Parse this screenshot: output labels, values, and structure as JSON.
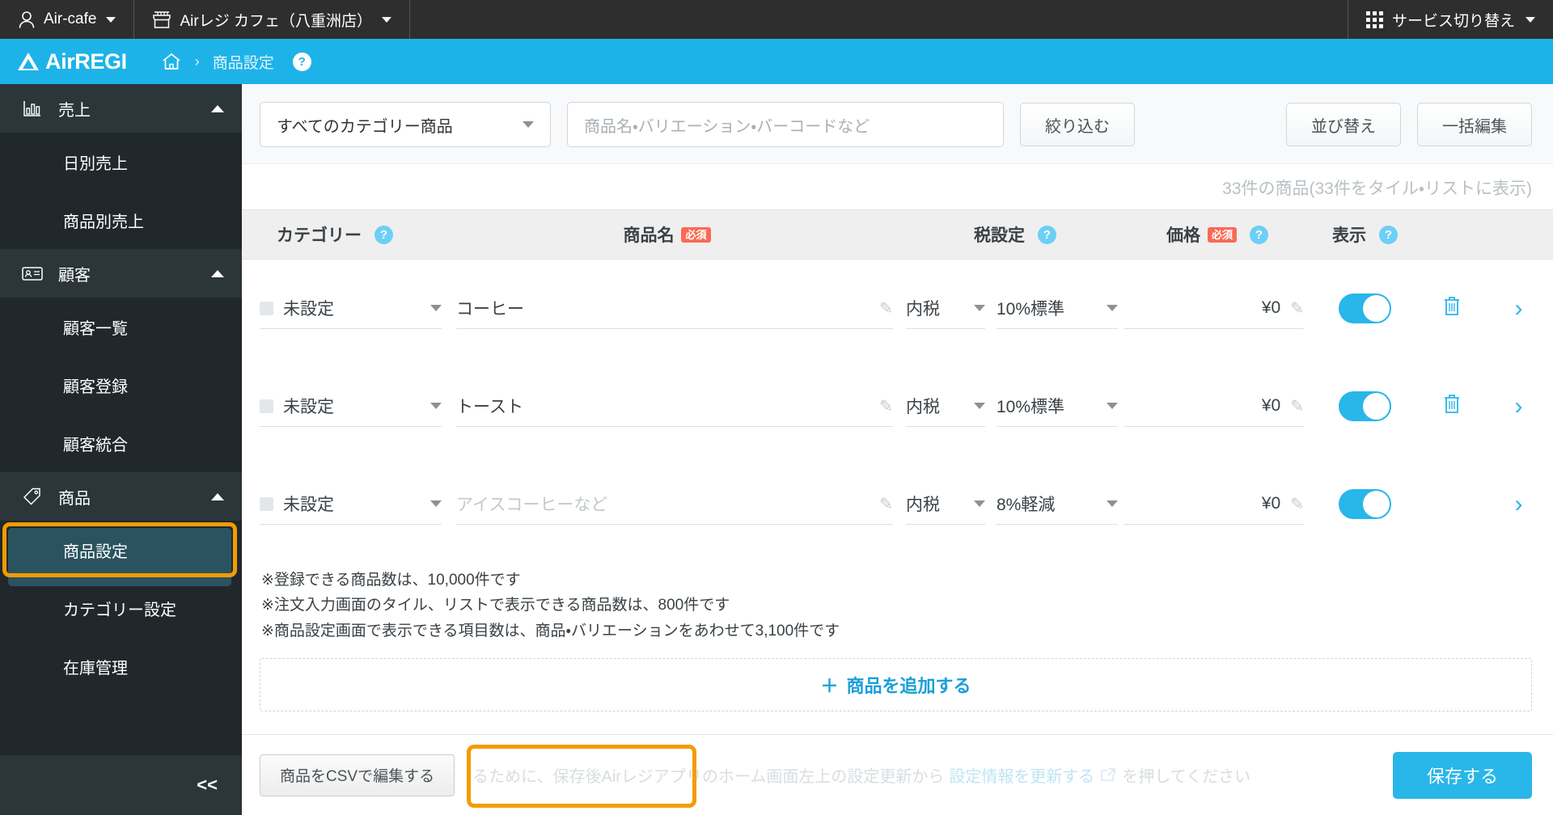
{
  "topbar": {
    "account_label": "Air-cafe",
    "account_icon": "person-icon",
    "store_label": "Airレジ カフェ（八重洲店）",
    "store_icon": "store-icon",
    "service_switch_label": "サービス切り替え",
    "service_switch_icon": "app-grid-icon"
  },
  "brandbar": {
    "logo_text": "AirREGI",
    "home_icon": "home-icon",
    "separator": "›",
    "current_crumb": "商品設定",
    "help_label": "?",
    "bg_color": "#1eb3e8"
  },
  "sidebar": {
    "groups": [
      {
        "label": "売上",
        "icon": "bar-chart-icon",
        "expanded": true,
        "items": [
          {
            "label": "日別売上",
            "active": false
          },
          {
            "label": "商品別売上",
            "active": false
          }
        ]
      },
      {
        "label": "顧客",
        "icon": "contact-card-icon",
        "expanded": true,
        "items": [
          {
            "label": "顧客一覧",
            "active": false
          },
          {
            "label": "顧客登録",
            "active": false
          },
          {
            "label": "顧客統合",
            "active": false
          }
        ]
      },
      {
        "label": "商品",
        "icon": "tag-icon",
        "expanded": true,
        "items": [
          {
            "label": "商品設定",
            "active": true
          },
          {
            "label": "カテゴリー設定",
            "active": false
          },
          {
            "label": "在庫管理",
            "active": false
          }
        ]
      }
    ],
    "collapse_label": "<<",
    "active_highlight_color": "#f59b00",
    "active_bg_color": "#2b535f"
  },
  "toolbar": {
    "category_select_value": "すべてのカテゴリー商品",
    "search_placeholder": "商品名・バリエーション・バーコードなど",
    "search_value": "",
    "filter_button_label": "絞り込む",
    "sort_button_label": "並び替え",
    "bulk_edit_button_label": "一括編集"
  },
  "count_text": "33件の商品(33件をタイル・リストに表示)",
  "table": {
    "headers": [
      {
        "label": "カテゴリー",
        "required": false,
        "help": true
      },
      {
        "label": "商品名",
        "required": true,
        "required_label": "必須",
        "help": false
      },
      {
        "label": "税設定",
        "required": false,
        "help": true
      },
      {
        "label": "価格",
        "required": true,
        "required_label": "必須",
        "help": true
      },
      {
        "label": "表示",
        "required": false,
        "help": true
      }
    ],
    "rows": [
      {
        "category": "未設定",
        "name_value": "コーヒー",
        "name_placeholder": "",
        "tax_in": "内税",
        "tax_rate": "10%標準",
        "price": "¥0",
        "visible": true,
        "has_delete": true,
        "arrow": "›"
      },
      {
        "category": "未設定",
        "name_value": "トースト",
        "name_placeholder": "",
        "tax_in": "内税",
        "tax_rate": "10%標準",
        "price": "¥0",
        "visible": true,
        "has_delete": true,
        "arrow": "›"
      },
      {
        "category": "未設定",
        "name_value": "",
        "name_placeholder": "アイスコーヒーなど",
        "tax_in": "内税",
        "tax_rate": "8%軽減",
        "price": "¥0",
        "visible": true,
        "has_delete": false,
        "arrow": "›"
      }
    ]
  },
  "notes": [
    "※登録できる商品数は、10,000件です",
    "※注文入力画面のタイル、リストで表示できる商品数は、800件です",
    "※商品設定画面で表示できる項目数は、商品・バリエーションをあわせて3,100件です"
  ],
  "add_product_label": "商品を追加する",
  "add_product_plus": "＋",
  "footer": {
    "csv_button_label": "商品をCSVで編集する",
    "note_prefix": "るために、保存後Airレジアプリのホーム画面左上の設定更新から",
    "note_link": "設定情報を更新する",
    "note_suffix": "を押してください",
    "external_icon": "external-link-icon",
    "save_button_label": "保存する",
    "save_button_color": "#29b6e8",
    "csv_highlight_color": "#f59b00"
  }
}
